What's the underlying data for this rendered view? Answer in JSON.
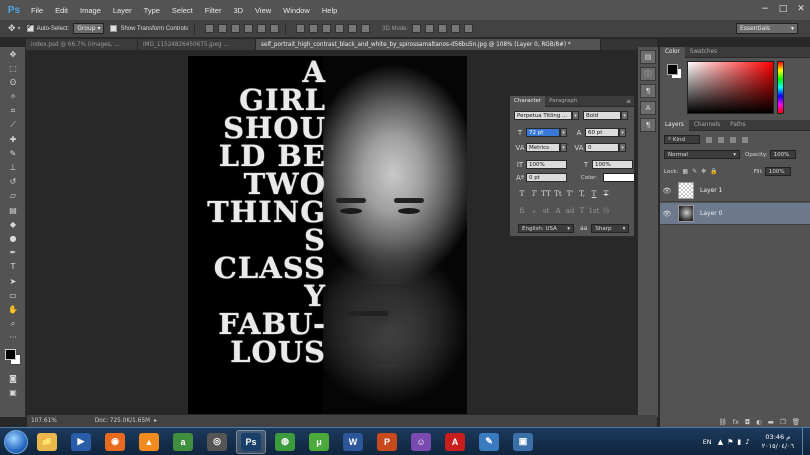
{
  "app": {
    "logo": "Ps"
  },
  "menu": [
    "File",
    "Edit",
    "Image",
    "Layer",
    "Type",
    "Select",
    "Filter",
    "3D",
    "View",
    "Window",
    "Help"
  ],
  "window_controls": {
    "minimize": "−",
    "maximize": "□",
    "close": "✕"
  },
  "options": {
    "auto_select_label": "Auto-Select:",
    "auto_select_checked": true,
    "auto_select_target": "Group",
    "show_transform_label": "Show Transform Controls",
    "mode_3d": "3D Mode:",
    "workspace": "Essentials"
  },
  "tabs": [
    {
      "label": "index.psd @ 66.7% (images, ...",
      "active": false
    },
    {
      "label": "IMG_11524826450675.jpeg ...",
      "active": false
    },
    {
      "label": "self_portrait_high_contrast_black_and_white_by_spirossamaltanos-d56bu5n.jpg @ 108% (Layer 0, RGB/8#) *",
      "active": true
    }
  ],
  "poster_lines": [
    "A",
    "GIRL",
    "SHOU",
    "LD BE",
    "TWO",
    "THING",
    "S",
    "CLASS",
    "Y",
    "FABU-",
    "LOUS"
  ],
  "character": {
    "tabs": [
      "Character",
      "Paragraph"
    ],
    "font_family": "Perpetua Titling ...",
    "font_style": "Bold",
    "size": "72 pt",
    "leading": "60 pt",
    "kerning": "Metrics",
    "tracking": "0",
    "vscale": "100%",
    "hscale": "100%",
    "baseline": "0 pt",
    "color_label": "Color:",
    "type_buttons": [
      "T",
      "T",
      "TT",
      "Tt",
      "T'",
      "T,",
      "T",
      "T"
    ],
    "ot_buttons": [
      "fi",
      "ℴ",
      "st",
      "A",
      "ad",
      "T",
      "1st",
      "½"
    ],
    "language": "English: USA",
    "aa_label": "aa",
    "antialias": "Sharp"
  },
  "color_panel": {
    "tabs": [
      "Color",
      "Swatches"
    ]
  },
  "layers_panel": {
    "tabs": [
      "Layers",
      "Channels",
      "Paths"
    ],
    "kind_filter": "Kind",
    "blend_mode": "Normal",
    "opacity_label": "Opacity:",
    "opacity": "100%",
    "lock_label": "Lock:",
    "fill_label": "Fill:",
    "fill": "100%",
    "layers": [
      {
        "name": "Layer 1",
        "selected": false
      },
      {
        "name": "Layer 0",
        "selected": true
      }
    ],
    "footer_icons": [
      "link-icon",
      "fx-icon",
      "mask-icon",
      "adjustment-icon",
      "folder-icon",
      "new-layer-icon",
      "trash-icon"
    ]
  },
  "status": {
    "zoom": "107.61%",
    "doc": "Doc: 725.0K/1.65M"
  },
  "taskbar": {
    "apps": [
      {
        "name": "explorer-icon",
        "active": false,
        "glyph": "📁",
        "color": "#e8b84a"
      },
      {
        "name": "media-player-icon",
        "active": false,
        "glyph": "▶",
        "color": "#2a5da8"
      },
      {
        "name": "firefox-icon",
        "active": false,
        "glyph": "◉",
        "color": "#e86a1f"
      },
      {
        "name": "vlc-icon",
        "active": false,
        "glyph": "▲",
        "color": "#f28a1e"
      },
      {
        "name": "arabic-app-icon",
        "active": false,
        "glyph": "a",
        "color": "#3f8f3f"
      },
      {
        "name": "app-icon",
        "active": false,
        "glyph": "◎",
        "color": "#555"
      },
      {
        "name": "photoshop-icon",
        "active": true,
        "glyph": "Ps",
        "color": "#1a3f6b"
      },
      {
        "name": "chrome-icon",
        "active": false,
        "glyph": "◍",
        "color": "#3c9b3c"
      },
      {
        "name": "utorrent-icon",
        "active": false,
        "glyph": "μ",
        "color": "#4caa3a"
      },
      {
        "name": "word-icon",
        "active": false,
        "glyph": "W",
        "color": "#2b579a"
      },
      {
        "name": "powerpoint-icon",
        "active": false,
        "glyph": "P",
        "color": "#c9491f"
      },
      {
        "name": "user-app-icon",
        "active": false,
        "glyph": "☺",
        "color": "#7a4ab0"
      },
      {
        "name": "pdf-icon",
        "active": false,
        "glyph": "A",
        "color": "#c81e1e"
      },
      {
        "name": "paint-icon",
        "active": false,
        "glyph": "✎",
        "color": "#3a7bc0"
      },
      {
        "name": "window-app-icon",
        "active": false,
        "glyph": "▣",
        "color": "#3a6fa8"
      }
    ],
    "language": "EN",
    "time": "03:46 م",
    "date": "٢٠١٥/٠٤/٠٦"
  }
}
